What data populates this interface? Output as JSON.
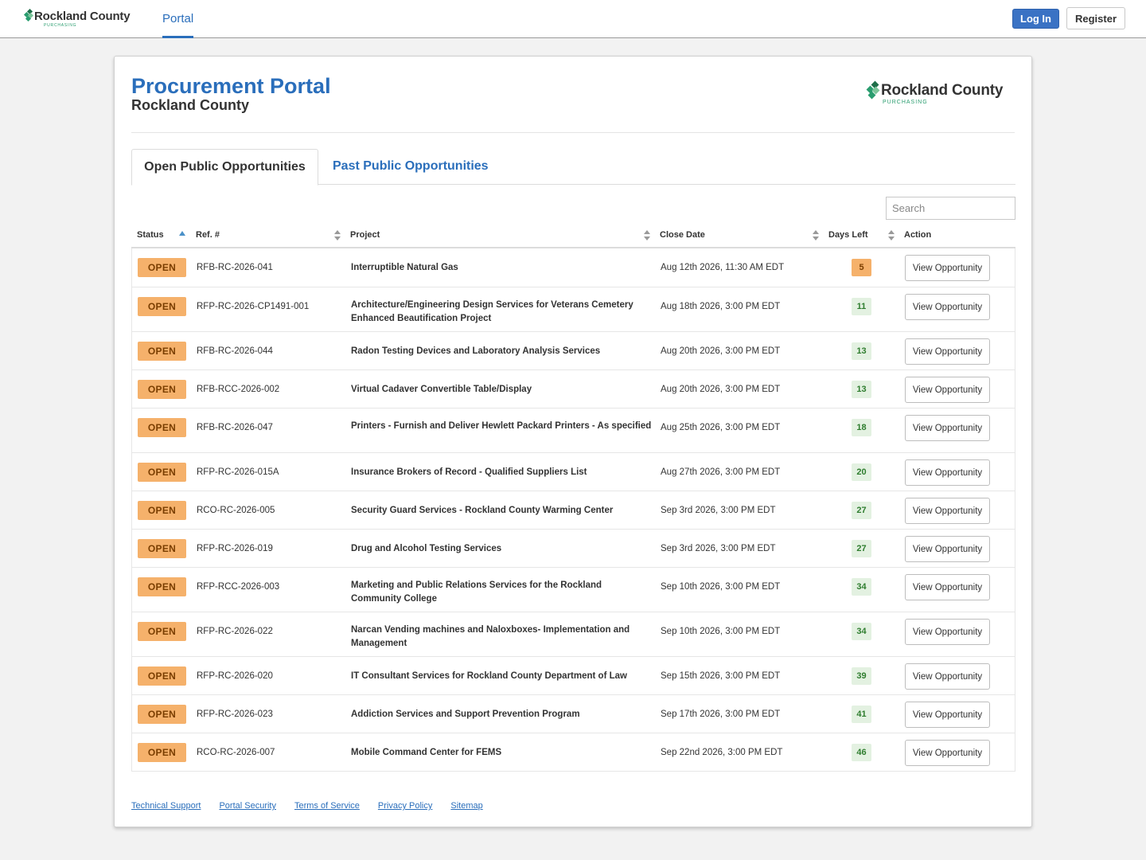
{
  "header": {
    "brand_name": "Rockland County",
    "brand_sub": "PURCHASING",
    "nav_portal": "Portal",
    "login_label": "Log In",
    "register_label": "Register"
  },
  "page": {
    "title": "Procurement Portal",
    "subtitle": "Rockland County",
    "logo_name": "Rockland County",
    "logo_sub": "PURCHASING"
  },
  "tabs": {
    "open_label": "Open Public Opportunities",
    "past_label": "Past Public Opportunities"
  },
  "search": {
    "placeholder": "Search"
  },
  "table": {
    "headers": {
      "status": "Status",
      "ref": "Ref. #",
      "project": "Project",
      "close_date": "Close Date",
      "days_left": "Days Left",
      "action": "Action"
    },
    "rows": [
      {
        "status": "OPEN",
        "ref": "RFB-RC-2026-041",
        "project": "Interruptible Natural Gas",
        "close": "Aug 12th 2026, 11:30 AM EDT",
        "days": "5",
        "urgent": true,
        "action": "View Opportunity"
      },
      {
        "status": "OPEN",
        "ref": "RFP-RC-2026-CP1491-001",
        "project": "Architecture/Engineering Design Services for Veterans Cemetery Enhanced Beautification Project",
        "close": "Aug 18th 2026, 3:00 PM EDT",
        "days": "11",
        "urgent": false,
        "action": "View Opportunity"
      },
      {
        "status": "OPEN",
        "ref": "RFB-RC-2026-044",
        "project": "Radon Testing Devices and Laboratory Analysis Services",
        "close": "Aug 20th 2026, 3:00 PM EDT",
        "days": "13",
        "urgent": false,
        "action": "View Opportunity"
      },
      {
        "status": "OPEN",
        "ref": "RFB-RCC-2026-002",
        "project": "Virtual Cadaver Convertible Table/Display",
        "close": "Aug 20th 2026, 3:00 PM EDT",
        "days": "13",
        "urgent": false,
        "action": "View Opportunity"
      },
      {
        "status": "OPEN",
        "ref": "RFB-RC-2026-047",
        "project": "Printers - Furnish and Deliver Hewlett Packard Printers - As specified",
        "close": "Aug 25th 2026, 3:00 PM EDT",
        "days": "18",
        "urgent": false,
        "action": "View Opportunity"
      },
      {
        "status": "OPEN",
        "ref": "RFP-RC-2026-015A",
        "project": "Insurance Brokers of Record - Qualified Suppliers List",
        "close": "Aug 27th 2026, 3:00 PM EDT",
        "days": "20",
        "urgent": false,
        "action": "View Opportunity"
      },
      {
        "status": "OPEN",
        "ref": "RCO-RC-2026-005",
        "project": "Security Guard Services - Rockland County Warming Center",
        "close": "Sep 3rd 2026, 3:00 PM EDT",
        "days": "27",
        "urgent": false,
        "action": "View Opportunity"
      },
      {
        "status": "OPEN",
        "ref": "RFP-RC-2026-019",
        "project": "Drug and Alcohol Testing Services",
        "close": "Sep 3rd 2026, 3:00 PM EDT",
        "days": "27",
        "urgent": false,
        "action": "View Opportunity"
      },
      {
        "status": "OPEN",
        "ref": "RFP-RCC-2026-003",
        "project": "Marketing and Public Relations Services for the Rockland Community College",
        "close": "Sep 10th 2026, 3:00 PM EDT",
        "days": "34",
        "urgent": false,
        "action": "View Opportunity"
      },
      {
        "status": "OPEN",
        "ref": "RFP-RC-2026-022",
        "project": "Narcan Vending machines and Naloxboxes- Implementation and Management",
        "close": "Sep 10th 2026, 3:00 PM EDT",
        "days": "34",
        "urgent": false,
        "action": "View Opportunity"
      },
      {
        "status": "OPEN",
        "ref": "RFP-RC-2026-020",
        "project": "IT Consultant Services for Rockland County Department of Law",
        "close": "Sep 15th 2026, 3:00 PM EDT",
        "days": "39",
        "urgent": false,
        "action": "View Opportunity"
      },
      {
        "status": "OPEN",
        "ref": "RFP-RC-2026-023",
        "project": "Addiction Services and Support Prevention Program",
        "close": "Sep 17th 2026, 3:00 PM EDT",
        "days": "41",
        "urgent": false,
        "action": "View Opportunity"
      },
      {
        "status": "OPEN",
        "ref": "RCO-RC-2026-007",
        "project": "Mobile Command Center for FEMS",
        "close": "Sep 22nd 2026, 3:00 PM EDT",
        "days": "46",
        "urgent": false,
        "action": "View Opportunity"
      }
    ]
  },
  "footer": {
    "links": [
      "Technical Support",
      "Portal Security",
      "Terms of Service",
      "Privacy Policy",
      "Sitemap"
    ]
  },
  "colors": {
    "accent": "#2a6ebb",
    "open_badge": "#f5b16b",
    "days_green": "#e3f1e1",
    "brand_green": "#2a9d6f"
  }
}
